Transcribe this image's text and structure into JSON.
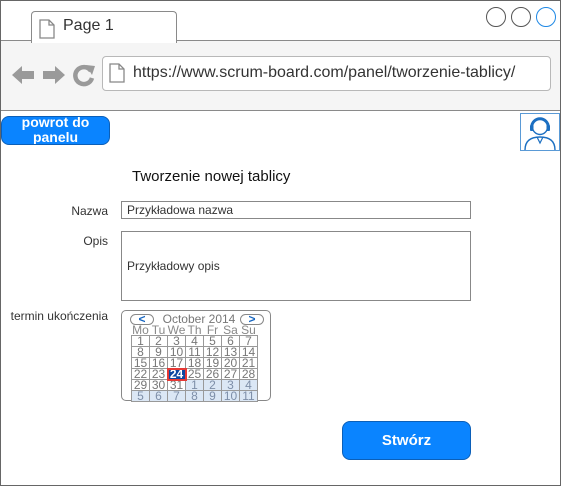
{
  "browser": {
    "tab_title": "Page 1",
    "url": "https://www.scrum-board.com/panel/tworzenie-tablicy/",
    "icons": [
      "back-arrow-icon",
      "forward-arrow-icon",
      "reload-icon",
      "page-icon"
    ]
  },
  "header": {
    "back_label": "powrot do panelu",
    "avatar_icon": "user-avatar-icon"
  },
  "form": {
    "title": "Tworzenie nowej tablicy",
    "name_label": "Nazwa",
    "name_value": "Przykładowa nazwa",
    "desc_label": "Opis",
    "desc_value": "Przykładowy opis",
    "deadline_label": "termin ukończenia",
    "submit_label": "Stwórz"
  },
  "calendar": {
    "prev": "<",
    "next": ">",
    "month": "October 2014",
    "weekdays": [
      "Mo",
      "Tu",
      "We",
      "Th",
      "Fr",
      "Sa",
      "Su"
    ],
    "weeks": [
      [
        "1",
        "2",
        "3",
        "4",
        "5",
        "6",
        "7"
      ],
      [
        "8",
        "9",
        "10",
        "11",
        "12",
        "13",
        "14"
      ],
      [
        "15",
        "16",
        "17",
        "18",
        "19",
        "20",
        "21"
      ],
      [
        "22",
        "23",
        "24",
        "25",
        "26",
        "27",
        "28"
      ],
      [
        "29",
        "30",
        "31",
        "1",
        "2",
        "3",
        "4"
      ],
      [
        "5",
        "6",
        "7",
        "8",
        "9",
        "10",
        "11"
      ]
    ],
    "selected": "24"
  },
  "colors": {
    "accent": "#0a84ff",
    "selected_day": "#0d47a1",
    "selected_outline": "#e53935",
    "other_month_bg": "#dbe7f5"
  }
}
